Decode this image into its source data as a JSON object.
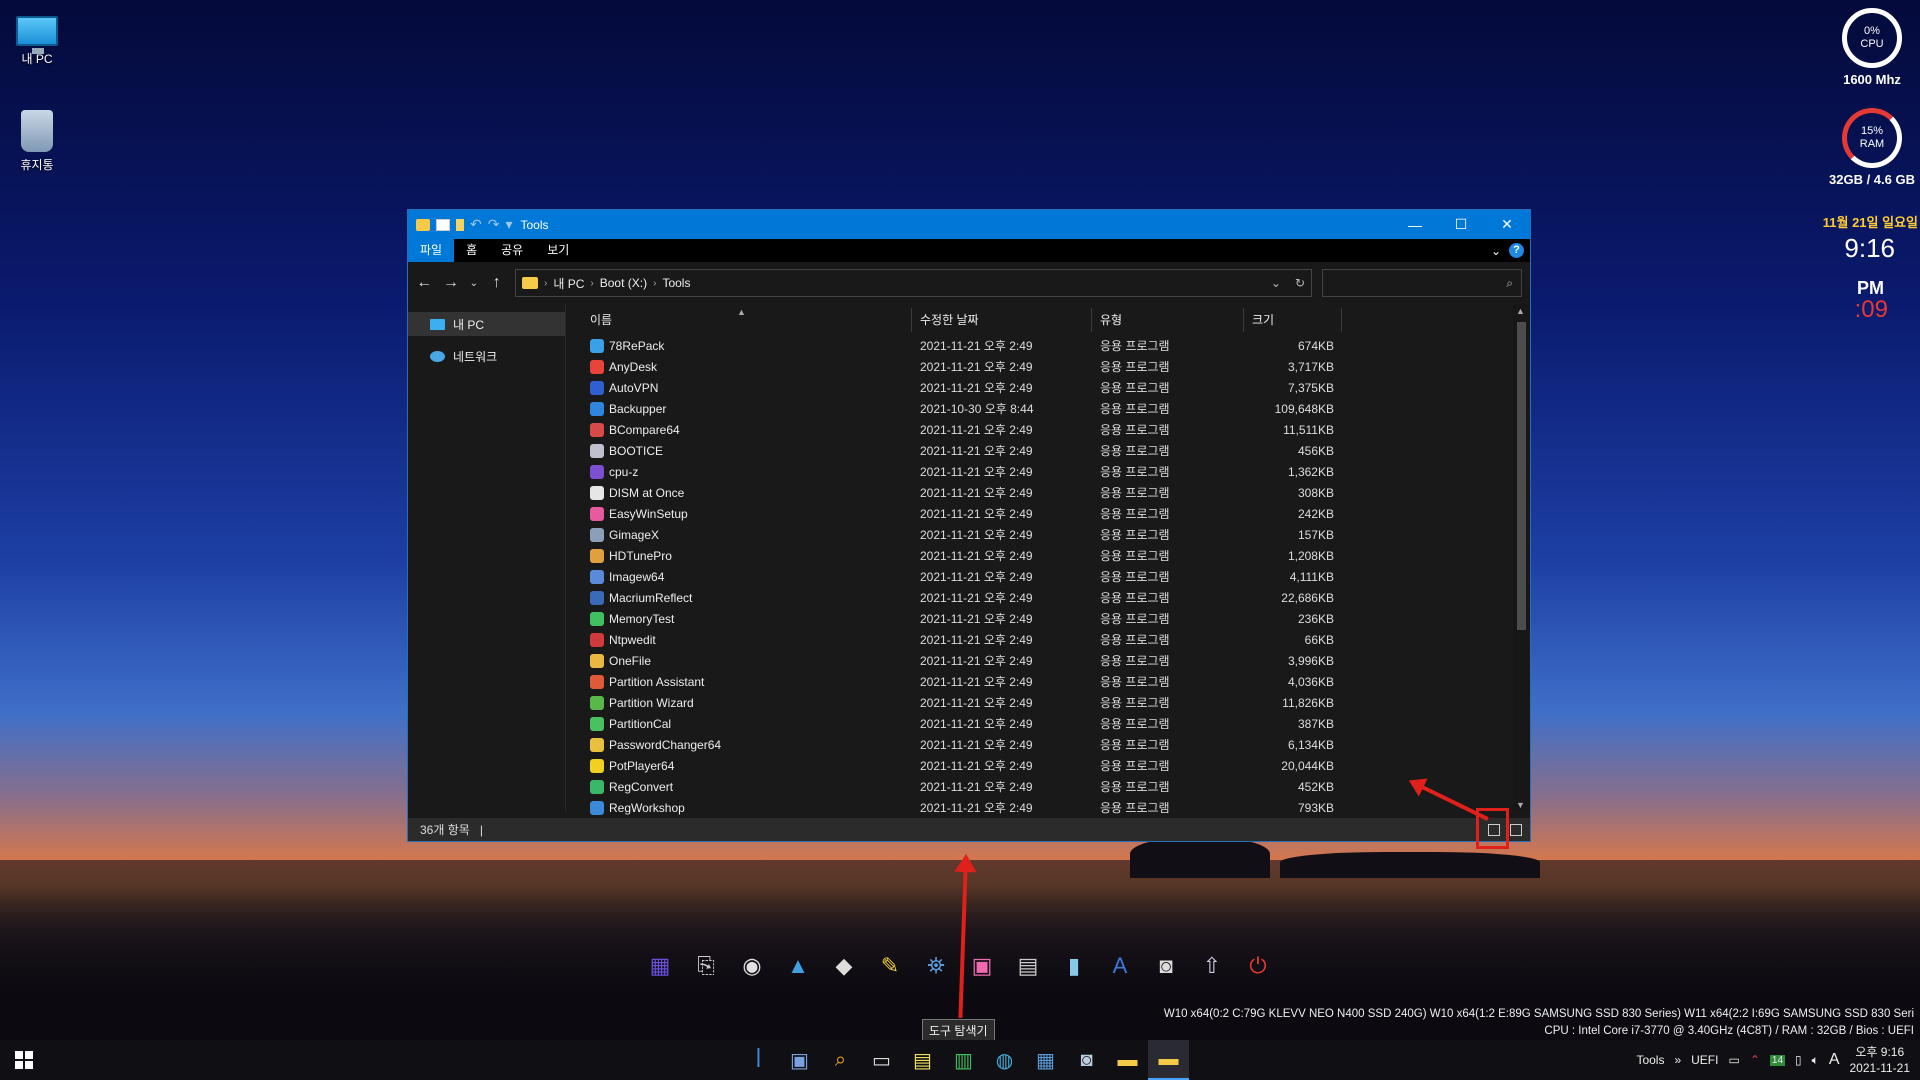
{
  "desktop": {
    "icons": [
      {
        "label": "내 PC",
        "icon": "computer-icon"
      },
      {
        "label": "휴지통",
        "icon": "recycle-bin-icon"
      }
    ]
  },
  "gadgets": {
    "cpu_percent": "0%",
    "cpu_label": "CPU",
    "cpu_freq": "1600 Mhz",
    "ram_percent": "15%",
    "ram_label": "RAM",
    "ram_usage": "32GB / 4.6 GB",
    "date": "11월 21일 일요일",
    "time": "9:16",
    "ampm": "PM",
    "seconds": ":09"
  },
  "window": {
    "title": "Tools",
    "ribbon_tabs": [
      "파일",
      "홈",
      "공유",
      "보기"
    ],
    "help": "?",
    "breadcrumb": [
      "내 PC",
      "Boot (X:)",
      "Tools"
    ],
    "search_placeholder": "",
    "nav_items": [
      "내 PC",
      "네트워크"
    ],
    "columns": [
      "이름",
      "수정한 날짜",
      "유형",
      "크기"
    ],
    "files": [
      {
        "name": "78RePack",
        "date": "2021-11-21 오후 2:49",
        "type": "응용 프로그램",
        "size": "674KB",
        "color": "#3aa0e8"
      },
      {
        "name": "AnyDesk",
        "date": "2021-11-21 오후 2:49",
        "type": "응용 프로그램",
        "size": "3,717KB",
        "color": "#e8443a"
      },
      {
        "name": "AutoVPN",
        "date": "2021-11-21 오후 2:49",
        "type": "응용 프로그램",
        "size": "7,375KB",
        "color": "#2f5fd0"
      },
      {
        "name": "Backupper",
        "date": "2021-10-30 오후 8:44",
        "type": "응용 프로그램",
        "size": "109,648KB",
        "color": "#2e86de"
      },
      {
        "name": "BCompare64",
        "date": "2021-11-21 오후 2:49",
        "type": "응용 프로그램",
        "size": "11,511KB",
        "color": "#d84a4a"
      },
      {
        "name": "BOOTICE",
        "date": "2021-11-21 오후 2:49",
        "type": "응용 프로그램",
        "size": "456KB",
        "color": "#c0c0d0"
      },
      {
        "name": "cpu-z",
        "date": "2021-11-21 오후 2:49",
        "type": "응용 프로그램",
        "size": "1,362KB",
        "color": "#7b4fd0"
      },
      {
        "name": "DISM at Once",
        "date": "2021-11-21 오후 2:49",
        "type": "응용 프로그램",
        "size": "308KB",
        "color": "#e6e6e6"
      },
      {
        "name": "EasyWinSetup",
        "date": "2021-11-21 오후 2:49",
        "type": "응용 프로그램",
        "size": "242KB",
        "color": "#e85aa0"
      },
      {
        "name": "GimageX",
        "date": "2021-11-21 오후 2:49",
        "type": "응용 프로그램",
        "size": "157KB",
        "color": "#8aa0b8"
      },
      {
        "name": "HDTunePro",
        "date": "2021-11-21 오후 2:49",
        "type": "응용 프로그램",
        "size": "1,208KB",
        "color": "#e0a040"
      },
      {
        "name": "Imagew64",
        "date": "2021-11-21 오후 2:49",
        "type": "응용 프로그램",
        "size": "4,111KB",
        "color": "#5a8ad8"
      },
      {
        "name": "MacriumReflect",
        "date": "2021-11-21 오후 2:49",
        "type": "응용 프로그램",
        "size": "22,686KB",
        "color": "#3a6ab8"
      },
      {
        "name": "MemoryTest",
        "date": "2021-11-21 오후 2:49",
        "type": "응용 프로그램",
        "size": "236KB",
        "color": "#40c060"
      },
      {
        "name": "Ntpwedit",
        "date": "2021-11-21 오후 2:49",
        "type": "응용 프로그램",
        "size": "66KB",
        "color": "#d03a3a"
      },
      {
        "name": "OneFile",
        "date": "2021-11-21 오후 2:49",
        "type": "응용 프로그램",
        "size": "3,996KB",
        "color": "#e8b840"
      },
      {
        "name": "Partition Assistant",
        "date": "2021-11-21 오후 2:49",
        "type": "응용 프로그램",
        "size": "4,036KB",
        "color": "#e05a3a"
      },
      {
        "name": "Partition Wizard",
        "date": "2021-11-21 오후 2:49",
        "type": "응용 프로그램",
        "size": "11,826KB",
        "color": "#5ab84a"
      },
      {
        "name": "PartitionCal",
        "date": "2021-11-21 오후 2:49",
        "type": "응용 프로그램",
        "size": "387KB",
        "color": "#4ac060"
      },
      {
        "name": "PasswordChanger64",
        "date": "2021-11-21 오후 2:49",
        "type": "응용 프로그램",
        "size": "6,134KB",
        "color": "#e8c040"
      },
      {
        "name": "PotPlayer64",
        "date": "2021-11-21 오후 2:49",
        "type": "응용 프로그램",
        "size": "20,044KB",
        "color": "#f0d020"
      },
      {
        "name": "RegConvert",
        "date": "2021-11-21 오후 2:49",
        "type": "응용 프로그램",
        "size": "452KB",
        "color": "#3ab86a"
      },
      {
        "name": "RegWorkshop",
        "date": "2021-11-21 오후 2:49",
        "type": "응용 프로그램",
        "size": "793KB",
        "color": "#3a8ad8"
      }
    ],
    "status_count": "36개 항목"
  },
  "dock": {
    "tooltip": "도구 탐색기",
    "items": [
      "cpu-icon",
      "usb-icon",
      "disc-icon",
      "triangle-icon",
      "diamond-icon",
      "pen-icon",
      "network-icon",
      "windows-icon",
      "drive-icon",
      "book-icon",
      "letter-a-icon",
      "camera-icon",
      "rocket-icon",
      "power-icon"
    ]
  },
  "sysinfo": {
    "line1": "W10  x64(0:2 C:79G KLEVV NEO N400 SSD 240G) W10  x64(1:2 E:89G SAMSUNG SSD 830 Series) W11  x64(2:2 I:69G SAMSUNG SSD 830 Seri",
    "line2": "CPU : Intel Core i7-3770 @ 3.40GHz (4C8T) / RAM : 32GB / Bios : UEFI"
  },
  "taskbar": {
    "tray_label": "Tools",
    "uefi": "UEFI",
    "ime": "A",
    "clock_time": "오후 9:16",
    "clock_date": "2021-11-21",
    "badge": "14"
  }
}
